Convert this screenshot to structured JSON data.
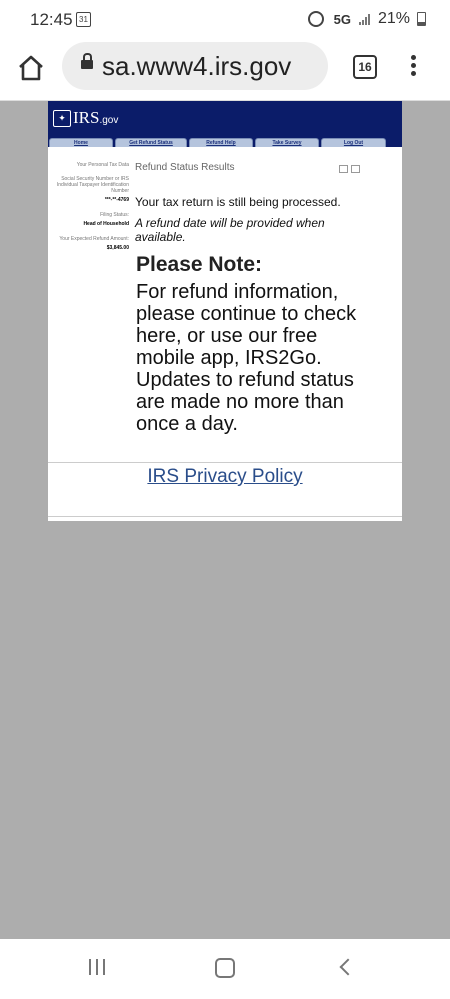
{
  "status_bar": {
    "time": "12:45",
    "calendar_day": "31",
    "network": "5G",
    "battery": "21%"
  },
  "browser": {
    "url": "sa.www4.irs.gov",
    "tab_count": "16"
  },
  "irs": {
    "logo": {
      "word": "IRS",
      "suffix": ".gov"
    },
    "nav": [
      "Home",
      "Get Refund Status",
      "Refund Help",
      "Take Survey",
      "Log Out"
    ],
    "left_panel": {
      "personal_heading": "Your Personal Tax Data",
      "ssn_label": "Social Security Number or IRS Individual Taxpayer Identification Number",
      "ssn_value": "***-**-4769",
      "filing_label": "Filing Status:",
      "filing_value": "Head of Household",
      "refund_label": "Your Expected Refund Amount:",
      "refund_value": "$3,845.00"
    },
    "results_title": "Refund Status Results",
    "processing_text": "Your tax return is still being processed.",
    "refund_date_text": "A refund date will be provided when available.",
    "note_title": "Please Note:",
    "note_body": "For refund information, please continue to check here, or use our free mobile app, IRS2Go. Updates to refund status are made no more than once a day.",
    "privacy_link": "IRS Privacy Policy"
  }
}
